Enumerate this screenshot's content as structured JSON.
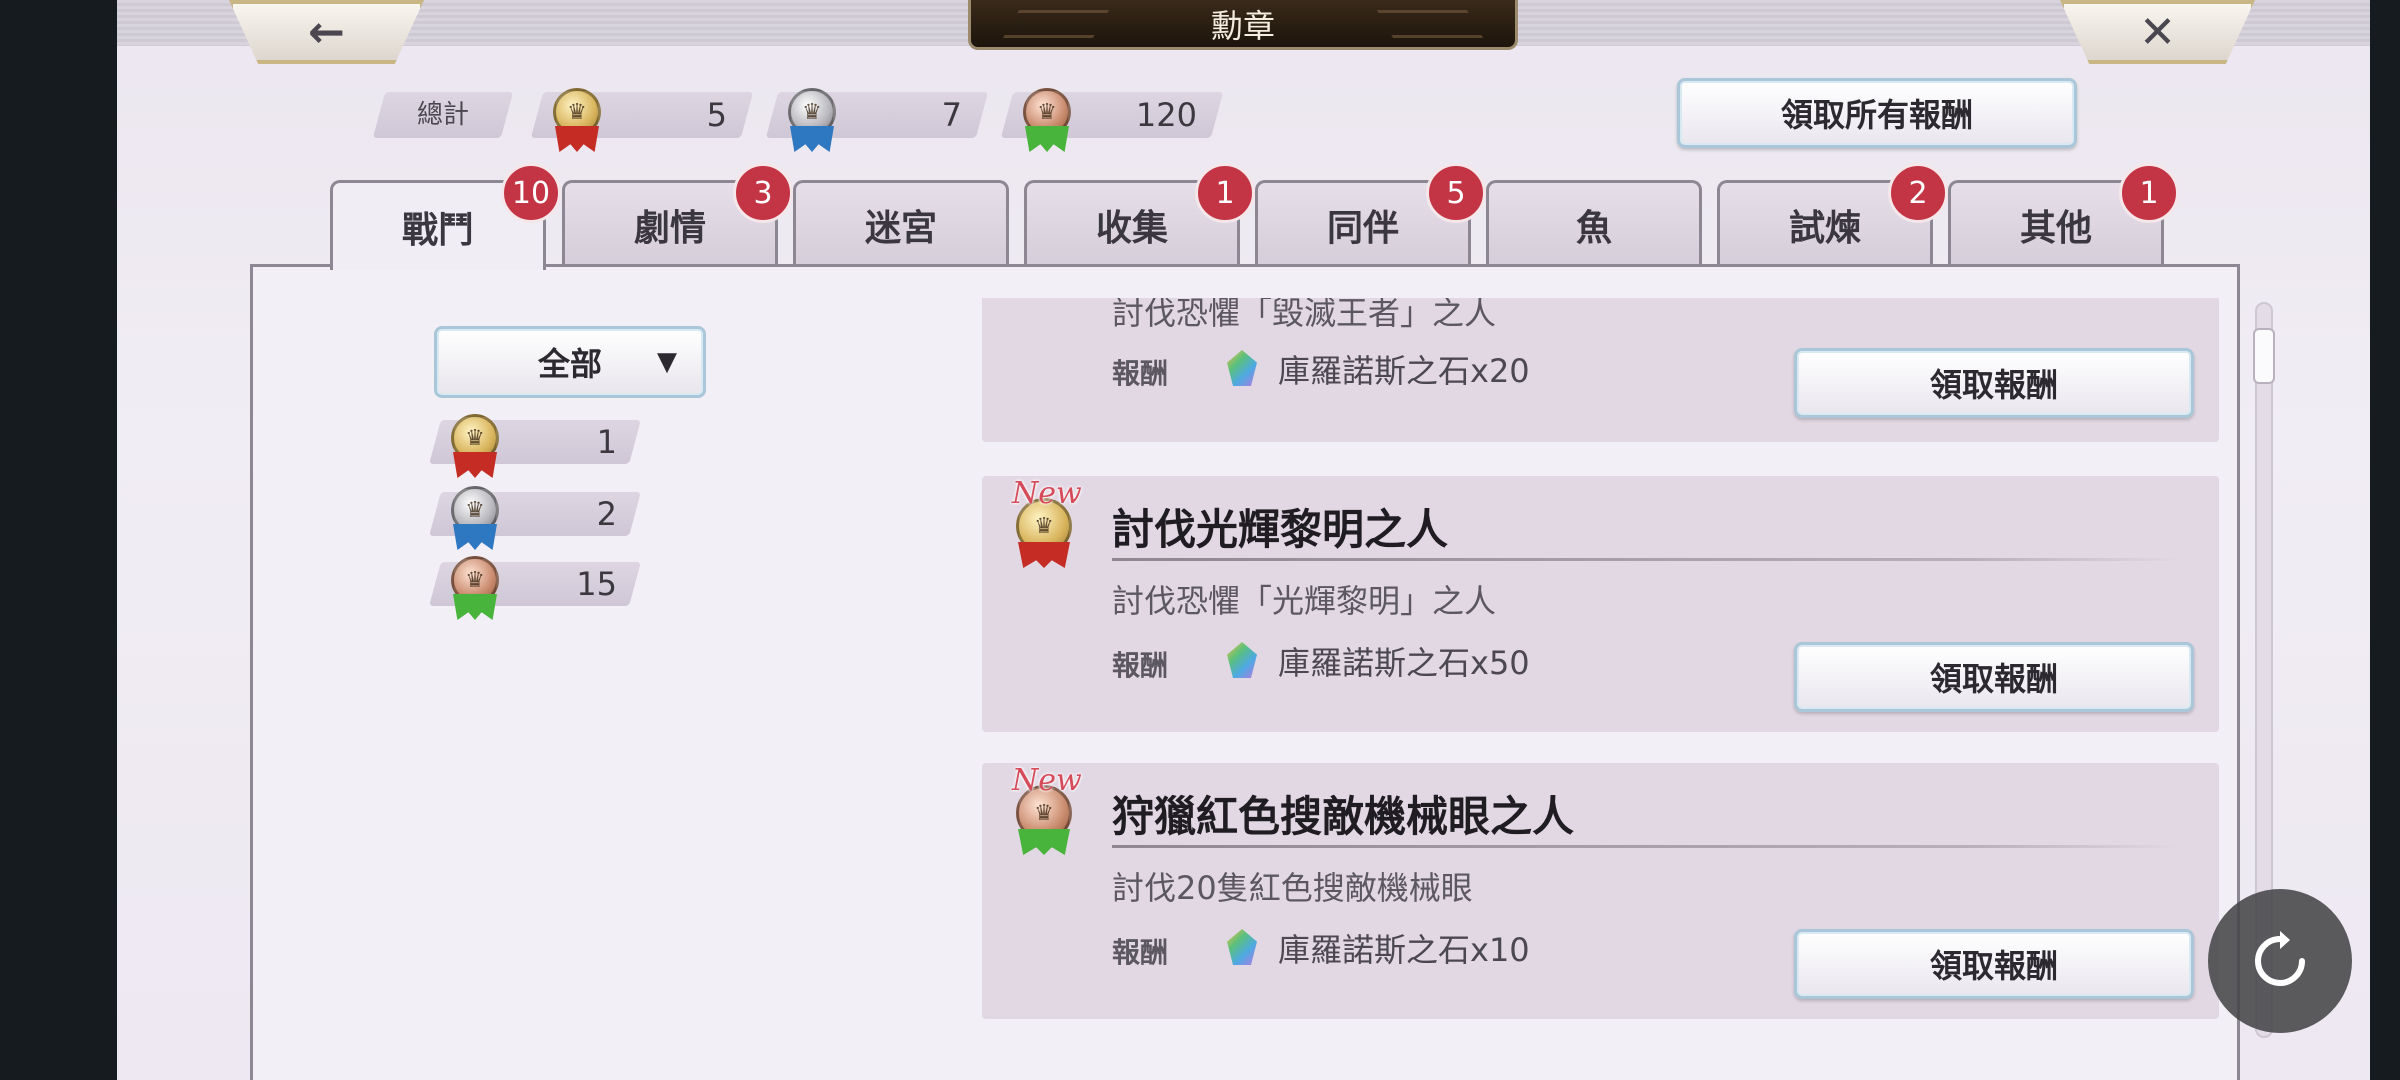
{
  "header": {
    "title": "勳章",
    "back_icon": "←",
    "close_icon": "✕"
  },
  "totals": {
    "label": "總計",
    "gold": "5",
    "silver": "7",
    "bronze": "120"
  },
  "claim_all_label": "領取所有報酬",
  "tabs": [
    {
      "label": "戰鬥",
      "badge": "10",
      "active": true
    },
    {
      "label": "劇情",
      "badge": "3"
    },
    {
      "label": "迷宮",
      "badge": ""
    },
    {
      "label": "收集",
      "badge": "1"
    },
    {
      "label": "同伴",
      "badge": "5"
    },
    {
      "label": "魚",
      "badge": ""
    },
    {
      "label": "試煉",
      "badge": "2"
    },
    {
      "label": "其他",
      "badge": "1"
    }
  ],
  "filter": {
    "selected": "全部",
    "caret": "▼",
    "counts": {
      "gold": "1",
      "silver": "2",
      "bronze": "15"
    }
  },
  "achievements": [
    {
      "title": "",
      "desc": "討伐恐懼「毀滅王者」之人",
      "reward_label": "報酬",
      "reward": "庫羅諾斯之石x20",
      "button": "領取報酬"
    },
    {
      "new_tag": "New",
      "medal": "gold",
      "title": "討伐光輝黎明之人",
      "desc": "討伐恐懼「光輝黎明」之人",
      "reward_label": "報酬",
      "reward": "庫羅諾斯之石x50",
      "button": "領取報酬"
    },
    {
      "new_tag": "New",
      "medal": "bronze",
      "title": "狩獵紅色搜敵機械眼之人",
      "desc": "討伐20隻紅色搜敵機械眼",
      "reward_label": "報酬",
      "reward": "庫羅諾斯之石x10",
      "button": "領取報酬"
    }
  ],
  "icons": {
    "refresh": "refresh-icon",
    "gem": "chronos-stone-icon"
  }
}
